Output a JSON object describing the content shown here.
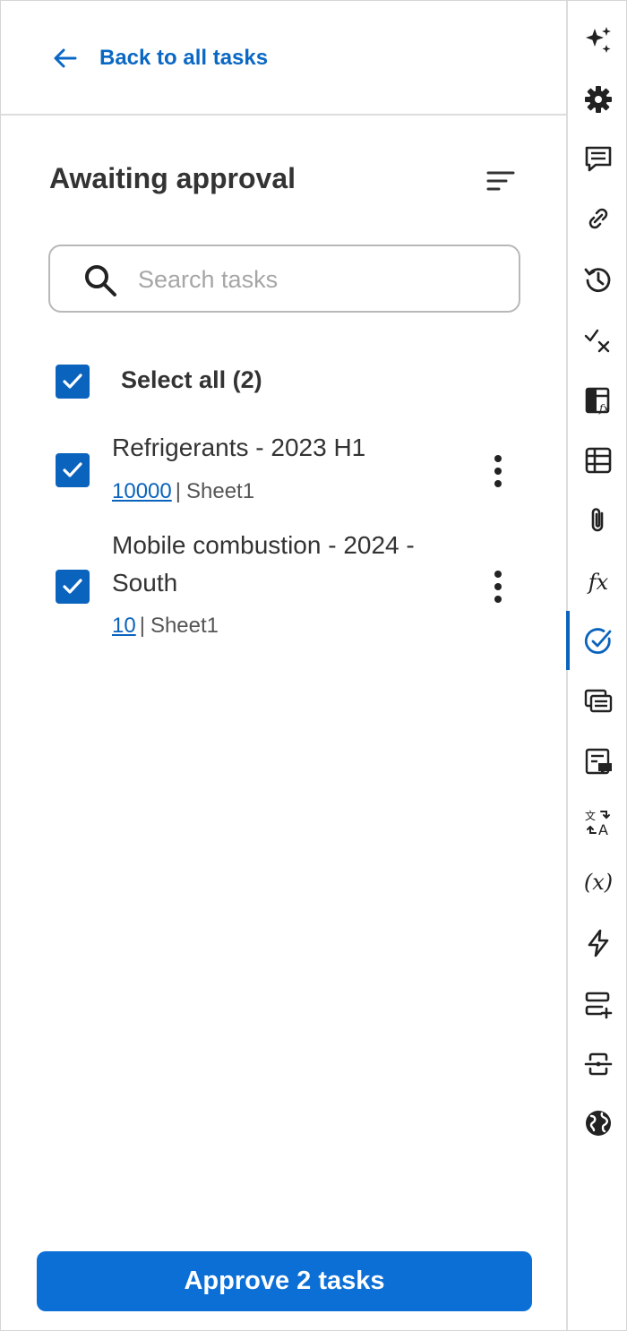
{
  "back_link": {
    "label": "Back to all tasks"
  },
  "header": {
    "title": "Awaiting approval"
  },
  "search": {
    "placeholder": "Search tasks",
    "value": ""
  },
  "select_all": {
    "label": "Select all (2)",
    "checked": true
  },
  "tasks": [
    {
      "title_line1": "Refrigerants - 2023 H1",
      "title_line2": "",
      "ref": "10000",
      "separator": "|",
      "sheet": "Sheet1",
      "checked": true
    },
    {
      "title_line1": "Mobile combustion - 2024 -",
      "title_line2": "South",
      "ref": "10",
      "separator": "|",
      "sheet": "Sheet1",
      "checked": true
    }
  ],
  "footer": {
    "approve_label": "Approve 2 tasks"
  },
  "rail": {
    "active_item": "tasks-check-icon",
    "items": [
      "sparkle-icon",
      "gear-icon",
      "comment-icon",
      "link-icon",
      "history-icon",
      "check-x-icon",
      "sheet-formula-icon",
      "table-icon",
      "paperclip-icon",
      "function-icon",
      "tasks-check-icon",
      "cards-icon",
      "note-comment-icon",
      "translate-icon",
      "variable-icon",
      "lightning-icon",
      "add-row-icon",
      "connector-icon",
      "globe-icon"
    ],
    "function_label": "fx",
    "variable_label": "(x)"
  },
  "colors": {
    "accent": "#0a63bd",
    "button": "#0b6fd6",
    "link": "#0a68c4"
  }
}
